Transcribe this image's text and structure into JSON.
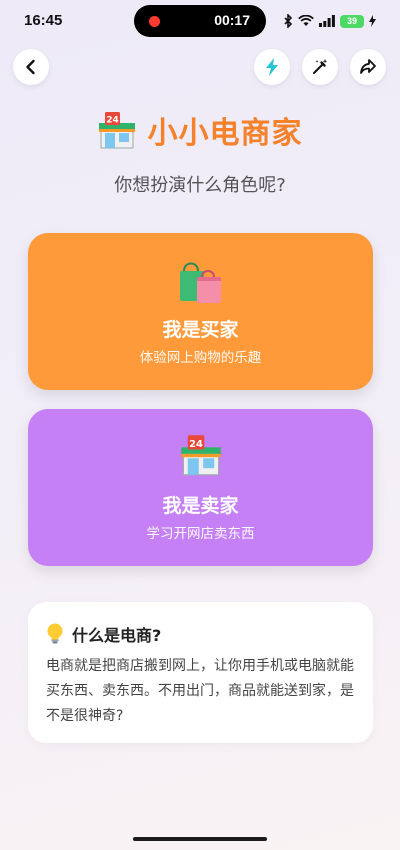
{
  "status_bar": {
    "time": "16:45",
    "recording_time": "00:17",
    "battery": "39"
  },
  "nav": {
    "back_icon": "chevron-left-icon",
    "actions": [
      "lightning-icon",
      "magic-wand-icon",
      "share-icon"
    ]
  },
  "header": {
    "title": "小小电商家",
    "subtitle": "你想扮演什么角色呢?"
  },
  "roles": [
    {
      "title": "我是买家",
      "desc": "体验网上购物的乐趣",
      "icon": "shopping-bags-icon",
      "color": "#fe9a3a"
    },
    {
      "title": "我是卖家",
      "desc": "学习开网店卖东西",
      "icon": "store-icon",
      "color": "#c580f5"
    }
  ],
  "info": {
    "icon": "light-bulb-icon",
    "title": "什么是电商?",
    "text": "电商就是把商店搬到网上，让你用手机或电脑就能买东西、卖东西。不用出门，商品就能送到家，是不是很神奇?"
  },
  "store_badge": "24"
}
